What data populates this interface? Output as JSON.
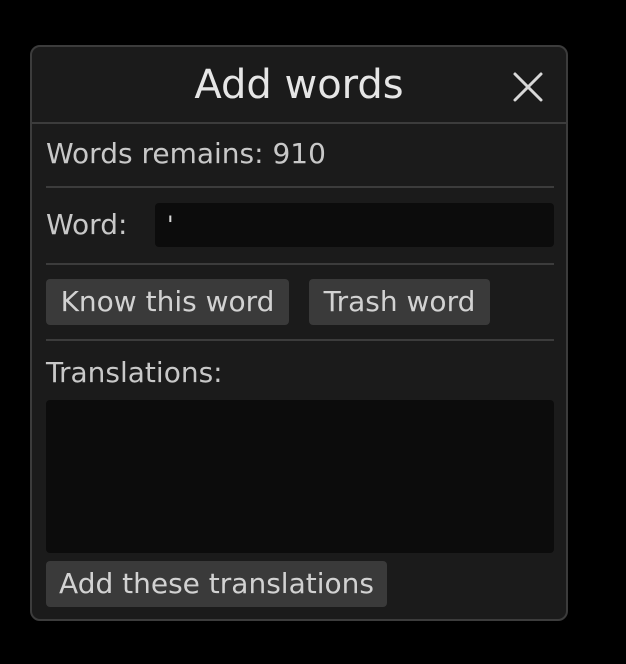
{
  "dialog": {
    "title": "Add words",
    "close_icon": "close-icon"
  },
  "status": {
    "words_remains_label": "Words remains: 910"
  },
  "word": {
    "label": "Word:",
    "value": "'"
  },
  "actions": {
    "know_label": "Know this word",
    "trash_label": "Trash word"
  },
  "translations": {
    "label": "Translations:",
    "value": "",
    "add_label": "Add these translations"
  },
  "colors": {
    "background": "#000000",
    "panel": "#1b1b1b",
    "border": "#3c3c3c",
    "button": "#3a3a3a",
    "input": "#0c0c0c",
    "text": "#c8c8c8"
  }
}
